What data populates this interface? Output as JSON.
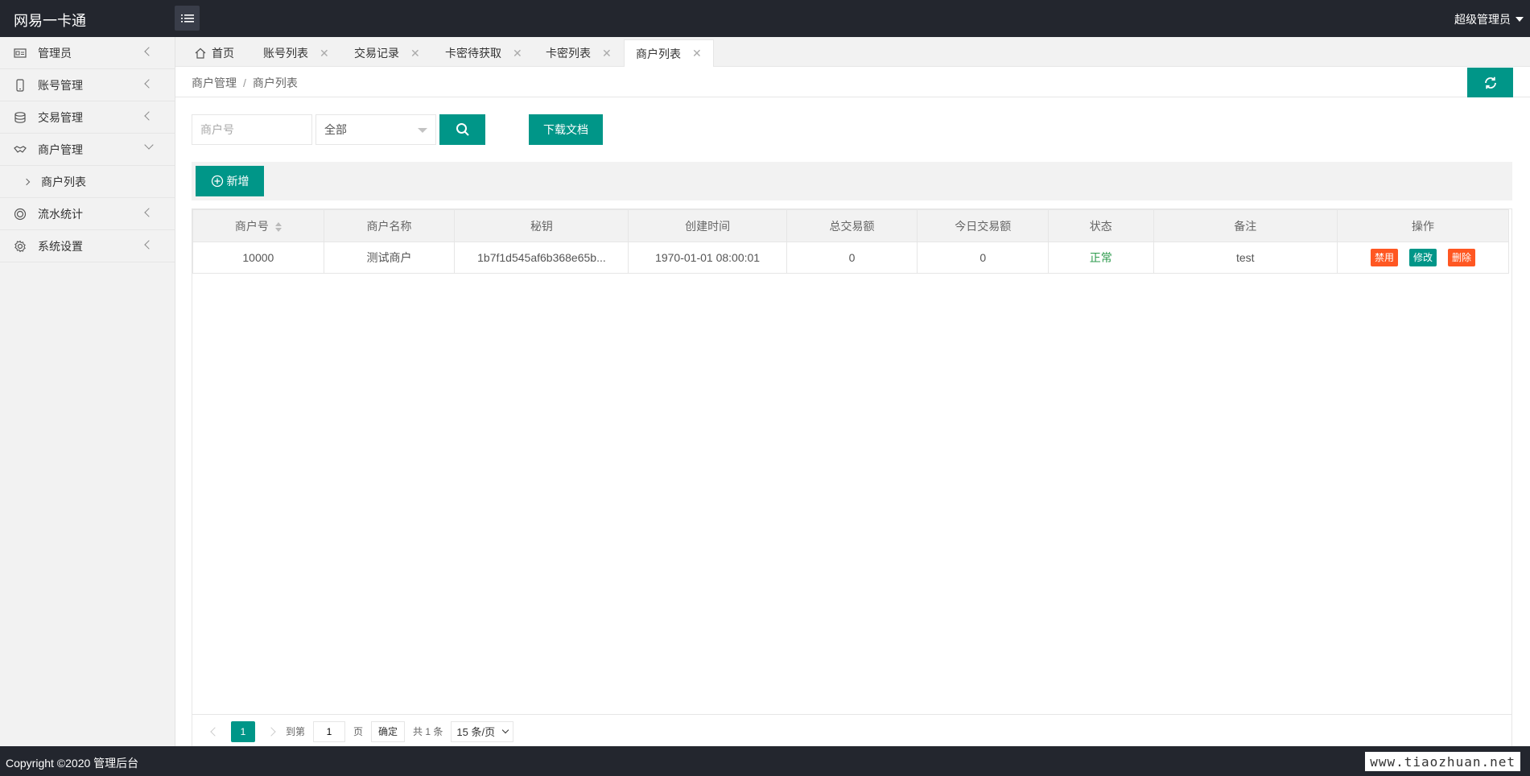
{
  "header": {
    "brand": "网易一卡通",
    "user": "超级管理员"
  },
  "sidebar": {
    "items": [
      {
        "label": "管理员",
        "icon": "id-card-icon"
      },
      {
        "label": "账号管理",
        "icon": "phone-icon"
      },
      {
        "label": "交易管理",
        "icon": "database-icon"
      },
      {
        "label": "商户管理",
        "icon": "handshake-icon",
        "expanded": true
      },
      {
        "label": "流水统计",
        "icon": "target-icon"
      },
      {
        "label": "系统设置",
        "icon": "gear-icon"
      }
    ],
    "sub": {
      "label": "商户列表"
    }
  },
  "tabs": [
    {
      "label": "首页"
    },
    {
      "label": "账号列表"
    },
    {
      "label": "交易记录"
    },
    {
      "label": "卡密待获取"
    },
    {
      "label": "卡密列表"
    },
    {
      "label": "商户列表",
      "active": true
    }
  ],
  "breadcrumb": {
    "parent": "商户管理",
    "sep": "/",
    "current": "商户列表"
  },
  "search": {
    "placeholder": "商户号",
    "select_value": "全部",
    "download_label": "下载文档"
  },
  "toolbar": {
    "add_label": "新增"
  },
  "table": {
    "headers": [
      "商户号",
      "商户名称",
      "秘钥",
      "创建时间",
      "总交易额",
      "今日交易额",
      "状态",
      "备注",
      "操作"
    ],
    "rows": [
      {
        "id": "10000",
        "name": "测试商户",
        "key": "1b7f1d545af6b368e65b...",
        "created": "1970-01-01 08:00:01",
        "total": "0",
        "today": "0",
        "status": "正常",
        "remark": "test",
        "ops": [
          "禁用",
          "修改",
          "删除"
        ]
      }
    ]
  },
  "pager": {
    "current": "1",
    "goto_label": "到第",
    "goto_value": "1",
    "page_label": "页",
    "ok_label": "确定",
    "total_label": "共 1 条",
    "size_label": "15 条/页"
  },
  "footer": {
    "copyright": "Copyright ©2020 管理后台",
    "watermark": "www.tiaozhuan.net"
  },
  "colors": {
    "accent": "#009688",
    "danger": "#ff5722",
    "dark": "#23262e"
  }
}
